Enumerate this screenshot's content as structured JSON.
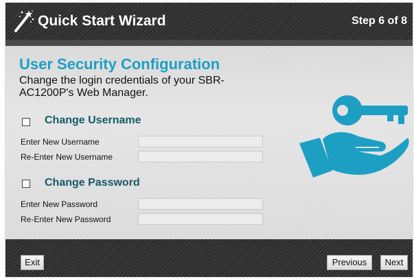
{
  "header": {
    "title": "Quick Start Wizard",
    "step": "Step 6 of 8",
    "icon": "magic-wand-icon"
  },
  "section": {
    "title": "User Security Configuration",
    "description": "Change the login credentials of your SBR-AC1200P's Web Manager."
  },
  "username_group": {
    "checkbox_checked": false,
    "title": "Change Username",
    "new_label": "Enter New Username",
    "new_value": "",
    "reenter_label": "Re-Enter New Username",
    "reenter_value": ""
  },
  "password_group": {
    "checkbox_checked": false,
    "title": "Change Password",
    "new_label": "Enter New Password",
    "new_value": "",
    "reenter_label": "Re-Enter New Password",
    "reenter_value": ""
  },
  "illustration": {
    "icon": "key-in-hand-icon",
    "color": "#1d9fc4"
  },
  "footer": {
    "exit_label": "Exit",
    "previous_label": "Previous",
    "next_label": "Next"
  },
  "colors": {
    "accent": "#1d9fc4",
    "group_title": "#155a6a",
    "header_bg": "#333333"
  }
}
